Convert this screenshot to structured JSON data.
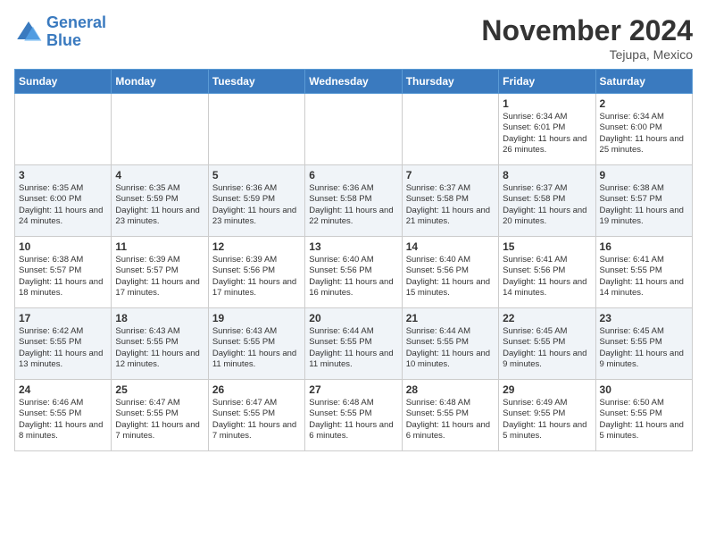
{
  "logo": {
    "line1": "General",
    "line2": "Blue"
  },
  "title": "November 2024",
  "subtitle": "Tejupa, Mexico",
  "days_of_week": [
    "Sunday",
    "Monday",
    "Tuesday",
    "Wednesday",
    "Thursday",
    "Friday",
    "Saturday"
  ],
  "weeks": [
    [
      {
        "day": "",
        "info": ""
      },
      {
        "day": "",
        "info": ""
      },
      {
        "day": "",
        "info": ""
      },
      {
        "day": "",
        "info": ""
      },
      {
        "day": "",
        "info": ""
      },
      {
        "day": "1",
        "info": "Sunrise: 6:34 AM\nSunset: 6:01 PM\nDaylight: 11 hours and 26 minutes."
      },
      {
        "day": "2",
        "info": "Sunrise: 6:34 AM\nSunset: 6:00 PM\nDaylight: 11 hours and 25 minutes."
      }
    ],
    [
      {
        "day": "3",
        "info": "Sunrise: 6:35 AM\nSunset: 6:00 PM\nDaylight: 11 hours and 24 minutes."
      },
      {
        "day": "4",
        "info": "Sunrise: 6:35 AM\nSunset: 5:59 PM\nDaylight: 11 hours and 23 minutes."
      },
      {
        "day": "5",
        "info": "Sunrise: 6:36 AM\nSunset: 5:59 PM\nDaylight: 11 hours and 23 minutes."
      },
      {
        "day": "6",
        "info": "Sunrise: 6:36 AM\nSunset: 5:58 PM\nDaylight: 11 hours and 22 minutes."
      },
      {
        "day": "7",
        "info": "Sunrise: 6:37 AM\nSunset: 5:58 PM\nDaylight: 11 hours and 21 minutes."
      },
      {
        "day": "8",
        "info": "Sunrise: 6:37 AM\nSunset: 5:58 PM\nDaylight: 11 hours and 20 minutes."
      },
      {
        "day": "9",
        "info": "Sunrise: 6:38 AM\nSunset: 5:57 PM\nDaylight: 11 hours and 19 minutes."
      }
    ],
    [
      {
        "day": "10",
        "info": "Sunrise: 6:38 AM\nSunset: 5:57 PM\nDaylight: 11 hours and 18 minutes."
      },
      {
        "day": "11",
        "info": "Sunrise: 6:39 AM\nSunset: 5:57 PM\nDaylight: 11 hours and 17 minutes."
      },
      {
        "day": "12",
        "info": "Sunrise: 6:39 AM\nSunset: 5:56 PM\nDaylight: 11 hours and 17 minutes."
      },
      {
        "day": "13",
        "info": "Sunrise: 6:40 AM\nSunset: 5:56 PM\nDaylight: 11 hours and 16 minutes."
      },
      {
        "day": "14",
        "info": "Sunrise: 6:40 AM\nSunset: 5:56 PM\nDaylight: 11 hours and 15 minutes."
      },
      {
        "day": "15",
        "info": "Sunrise: 6:41 AM\nSunset: 5:56 PM\nDaylight: 11 hours and 14 minutes."
      },
      {
        "day": "16",
        "info": "Sunrise: 6:41 AM\nSunset: 5:55 PM\nDaylight: 11 hours and 14 minutes."
      }
    ],
    [
      {
        "day": "17",
        "info": "Sunrise: 6:42 AM\nSunset: 5:55 PM\nDaylight: 11 hours and 13 minutes."
      },
      {
        "day": "18",
        "info": "Sunrise: 6:43 AM\nSunset: 5:55 PM\nDaylight: 11 hours and 12 minutes."
      },
      {
        "day": "19",
        "info": "Sunrise: 6:43 AM\nSunset: 5:55 PM\nDaylight: 11 hours and 11 minutes."
      },
      {
        "day": "20",
        "info": "Sunrise: 6:44 AM\nSunset: 5:55 PM\nDaylight: 11 hours and 11 minutes."
      },
      {
        "day": "21",
        "info": "Sunrise: 6:44 AM\nSunset: 5:55 PM\nDaylight: 11 hours and 10 minutes."
      },
      {
        "day": "22",
        "info": "Sunrise: 6:45 AM\nSunset: 5:55 PM\nDaylight: 11 hours and 9 minutes."
      },
      {
        "day": "23",
        "info": "Sunrise: 6:45 AM\nSunset: 5:55 PM\nDaylight: 11 hours and 9 minutes."
      }
    ],
    [
      {
        "day": "24",
        "info": "Sunrise: 6:46 AM\nSunset: 5:55 PM\nDaylight: 11 hours and 8 minutes."
      },
      {
        "day": "25",
        "info": "Sunrise: 6:47 AM\nSunset: 5:55 PM\nDaylight: 11 hours and 7 minutes."
      },
      {
        "day": "26",
        "info": "Sunrise: 6:47 AM\nSunset: 5:55 PM\nDaylight: 11 hours and 7 minutes."
      },
      {
        "day": "27",
        "info": "Sunrise: 6:48 AM\nSunset: 5:55 PM\nDaylight: 11 hours and 6 minutes."
      },
      {
        "day": "28",
        "info": "Sunrise: 6:48 AM\nSunset: 5:55 PM\nDaylight: 11 hours and 6 minutes."
      },
      {
        "day": "29",
        "info": "Sunrise: 6:49 AM\nSunset: 9:55 PM\nDaylight: 11 hours and 5 minutes."
      },
      {
        "day": "30",
        "info": "Sunrise: 6:50 AM\nSunset: 5:55 PM\nDaylight: 11 hours and 5 minutes."
      }
    ]
  ]
}
